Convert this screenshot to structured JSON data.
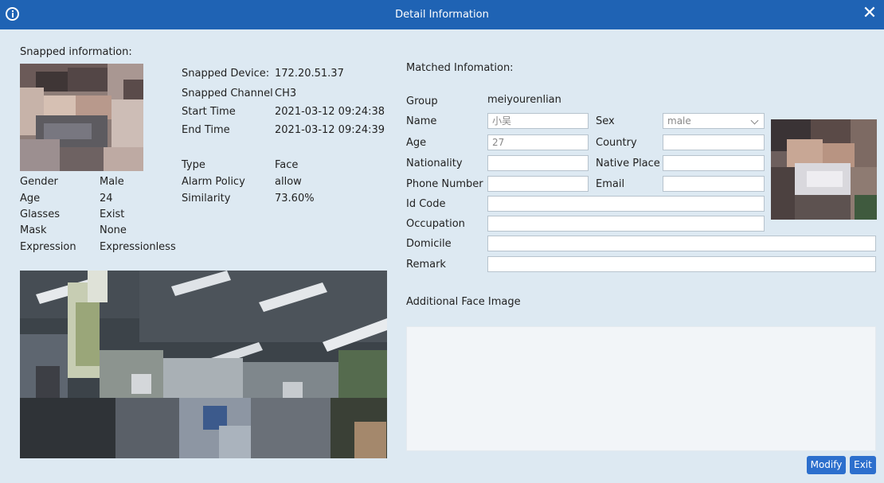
{
  "window": {
    "title": "Detail Information"
  },
  "snapped": {
    "heading": "Snapped information:",
    "device_label": "Snapped Device:",
    "device_value": "172.20.51.37",
    "channel_label": "Snapped Channel",
    "channel_value": "CH3",
    "start_label": "Start Time",
    "start_value": "2021-03-12 09:24:38",
    "end_label": "End Time",
    "end_value": "2021-03-12 09:24:39",
    "type_label": "Type",
    "type_value": "Face",
    "policy_label": "Alarm Policy",
    "policy_value": "allow",
    "similarity_label": "Similarity",
    "similarity_value": "73.60%",
    "attributes": [
      {
        "label": "Gender",
        "value": "Male"
      },
      {
        "label": "Age",
        "value": "24"
      },
      {
        "label": "Glasses",
        "value": "Exist"
      },
      {
        "label": "Mask",
        "value": "None"
      },
      {
        "label": "Expression",
        "value": "Expressionless"
      }
    ]
  },
  "matched": {
    "heading": "Matched Infomation:",
    "group_label": "Group",
    "group_value": "meiyourenlian",
    "name_label": "Name",
    "name_value": "小吴",
    "sex_label": "Sex",
    "sex_value": "male",
    "age_label": "Age",
    "age_value": "27",
    "country_label": "Country",
    "country_value": "",
    "nationality_label": "Nationality",
    "nationality_value": "",
    "native_place_label": "Native Place",
    "native_place_value": "",
    "phone_label": "Phone Number",
    "phone_value": "",
    "email_label": "Email",
    "email_value": "",
    "id_code_label": "Id Code",
    "id_code_value": "",
    "occupation_label": "Occupation",
    "occupation_value": "",
    "domicile_label": "Domicile",
    "domicile_value": "",
    "remark_label": "Remark",
    "remark_value": ""
  },
  "additional": {
    "heading": "Additional Face Image"
  },
  "buttons": {
    "modify": "Modify",
    "exit": "Exit"
  },
  "icons": {
    "info": "info-icon",
    "close": "close-icon",
    "dropdown": "chevron-down-icon"
  },
  "colors": {
    "titlebar": "#1f63b4",
    "background": "#dde9f2",
    "button": "#2c6fcd"
  }
}
